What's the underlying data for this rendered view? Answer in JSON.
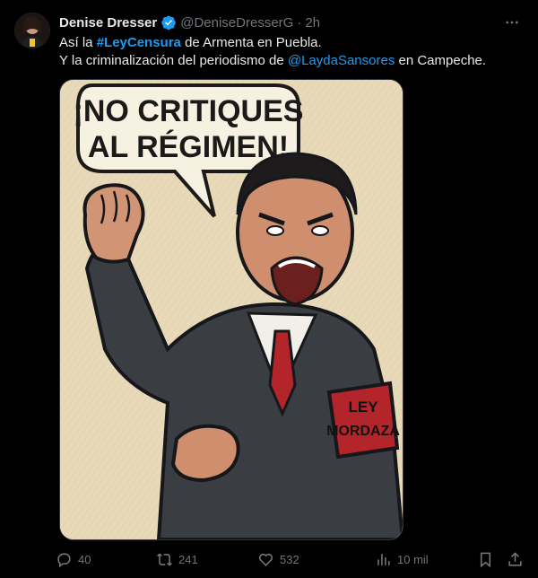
{
  "tweet": {
    "author_name": "Denise Dresser",
    "handle": "@DeniseDresserG",
    "separator": "·",
    "time": "2h",
    "line1": {
      "prefix": "Así la ",
      "hashtag": "#LeyCensura",
      "suffix": " de Armenta en Puebla."
    },
    "line2": {
      "prefix": "Y la criminalización del periodismo de ",
      "mention": "@LaydaSansores",
      "suffix": " en Campeche."
    }
  },
  "image": {
    "speech_line1": "¡NO CRITIQUES",
    "speech_line2": "AL RÉGIMEN!",
    "armband_line1": "LEY",
    "armband_line2": "MORDAZA"
  },
  "actions": {
    "replies": "40",
    "retweets": "241",
    "likes": "532",
    "views": "10 mil"
  },
  "icons": {
    "verified": "verified-badge-icon",
    "more": "more-dots-icon",
    "reply": "reply-icon",
    "retweet": "retweet-icon",
    "like": "heart-icon",
    "views": "views-bar-icon",
    "bookmark": "bookmark-icon",
    "share": "share-icon"
  },
  "colors": {
    "background": "#000000",
    "text": "#e7e9ea",
    "muted": "#71767b",
    "link": "#1d9bf0"
  }
}
